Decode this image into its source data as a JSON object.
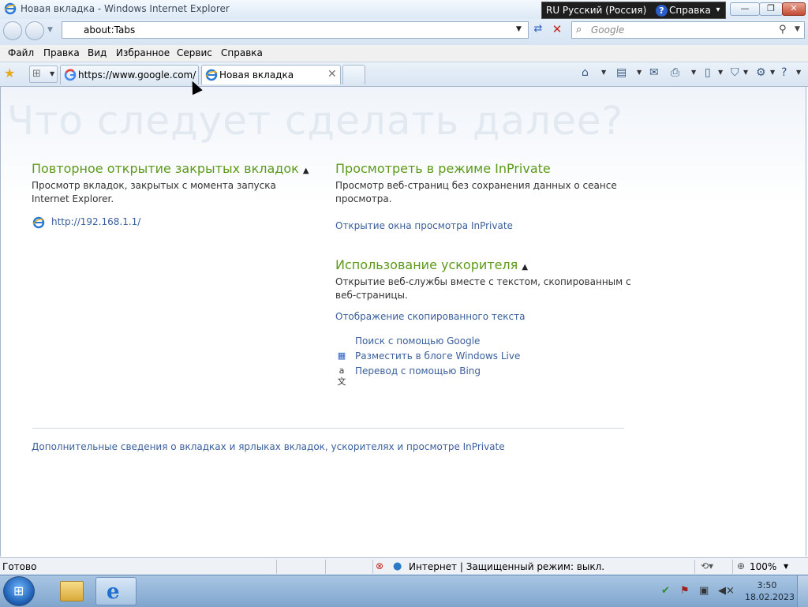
{
  "window": {
    "title": "Новая вкладка - Windows Internet Explorer",
    "language_bar": {
      "lang": "RU Русский (Россия)",
      "help": "Справка",
      "help_icon": "?"
    },
    "controls": {
      "minimize": "—",
      "maximize": "❐",
      "close": "✕"
    }
  },
  "nav": {
    "address": "about:Tabs",
    "search_placeholder": "Google"
  },
  "menu": [
    "Файл",
    "Правка",
    "Вид",
    "Избранное",
    "Сервис",
    "Справка"
  ],
  "tabs": [
    {
      "label": "https://www.google.com/...",
      "icon": "google-icon",
      "active": false
    },
    {
      "label": "Новая вкладка",
      "icon": "ie-icon",
      "active": true,
      "close": "✕"
    },
    {
      "label": "",
      "icon": "new-tab",
      "active": false
    }
  ],
  "command_bar": [
    "home-icon",
    "feeds-icon",
    "mail-icon",
    "print-icon",
    "page-icon",
    "safety-icon",
    "tools-icon",
    "help-icon"
  ],
  "content": {
    "heading": "Что следует сделать далее?",
    "reopen": {
      "title": "Повторное открытие закрытых вкладок",
      "text": "Просмотр вкладок, закрытых с момента запуска Internet Explorer.",
      "links": [
        "http://192.168.1.1/"
      ]
    },
    "inprivate": {
      "title": "Просмотреть в режиме InPrivate",
      "text": "Просмотр веб-страниц без сохранения данных о сеансе просмотра.",
      "link": "Открытие окна просмотра InPrivate"
    },
    "accelerators": {
      "title": "Использование ускорителя",
      "text": "Открытие веб-службы вместе с текстом, скопированным с веб-страницы.",
      "show_copied": "Отображение скопированного текста",
      "items": [
        "Поиск с помощью Google",
        "Разместить в блоге Windows Live",
        "Перевод с помощью Bing"
      ]
    },
    "more_info": "Дополнительные сведения о вкладках и ярлыках вкладок, ускорителях и просмотре InPrivate"
  },
  "status": {
    "text": "Готово",
    "zone": "Интернет | Защищенный режим: выкл.",
    "zoom": "100%"
  },
  "taskbar": {
    "clock_time": "3:50",
    "clock_date": "18.02.2023"
  },
  "colors": {
    "section_title": "#5d9a1a",
    "link": "#3a5f9c",
    "heading_watermark": "#e3e9f1"
  }
}
